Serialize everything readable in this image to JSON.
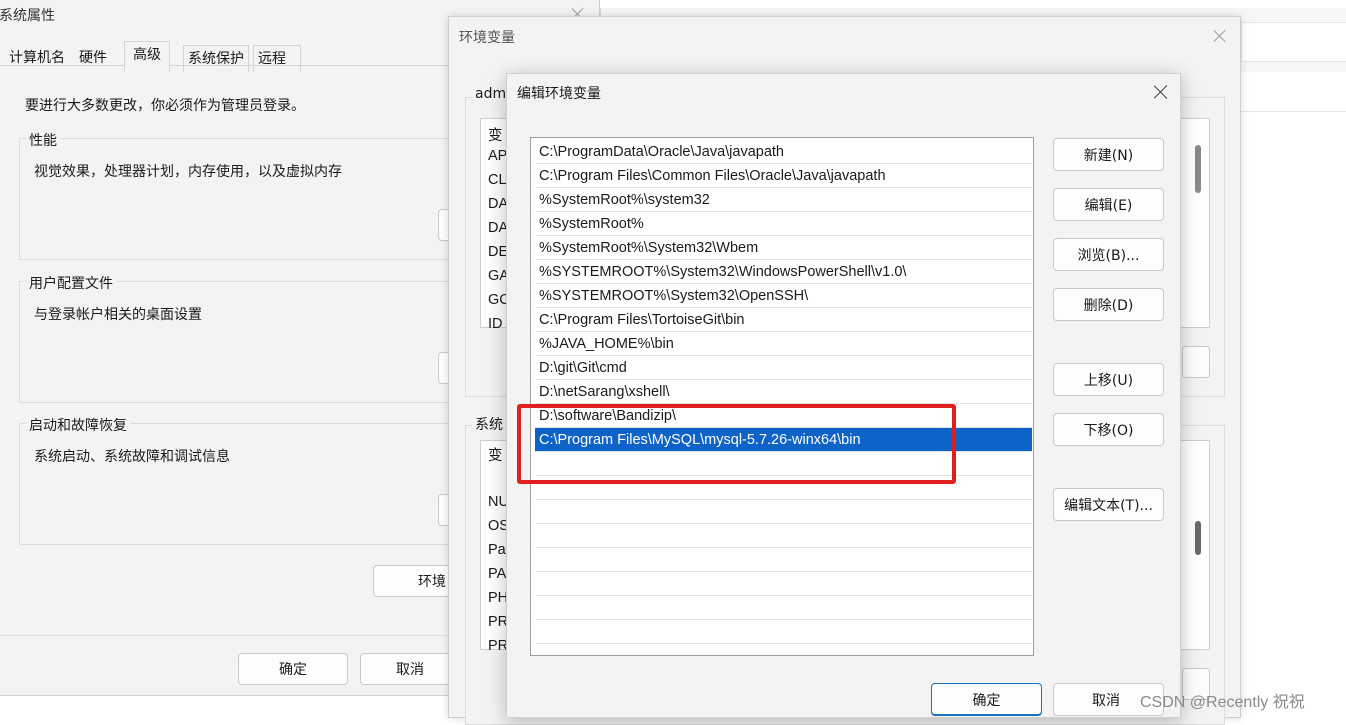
{
  "system_properties": {
    "title": "系统属性",
    "tabs": [
      "计算机名",
      "硬件",
      "高级",
      "系统保护",
      "远程"
    ],
    "admin_note": "要进行大多数更改，你必须作为管理员登录。",
    "performance": {
      "title": "性能",
      "desc": "视觉效果，处理器计划，内存使用，以及虚拟内存"
    },
    "user_profiles": {
      "title": "用户配置文件",
      "desc": "与登录帐户相关的桌面设置"
    },
    "startup_recovery": {
      "title": "启动和故障恢复",
      "desc": "系统启动、系统故障和调试信息"
    },
    "env_button_partial": "环境",
    "ok": "确定",
    "cancel": "取消"
  },
  "env_vars": {
    "title": "环境变量",
    "user_section_partial": "adm",
    "system_section_partial": "系统",
    "user_header_partial": "变",
    "user_vars_partial": [
      "AP",
      "CL",
      "DA",
      "DA",
      "DE",
      "GA",
      "GC",
      "ID"
    ],
    "system_header_partial": "变",
    "system_vars_partial": [
      "NU",
      "OS",
      "Pa",
      "PA",
      "PH",
      "PR",
      "PR"
    ]
  },
  "edit_env": {
    "title": "编辑环境变量",
    "paths": [
      "C:\\ProgramData\\Oracle\\Java\\javapath",
      "C:\\Program Files\\Common Files\\Oracle\\Java\\javapath",
      "%SystemRoot%\\system32",
      "%SystemRoot%",
      "%SystemRoot%\\System32\\Wbem",
      "%SYSTEMROOT%\\System32\\WindowsPowerShell\\v1.0\\",
      "%SYSTEMROOT%\\System32\\OpenSSH\\",
      "C:\\Program Files\\TortoiseGit\\bin",
      "%JAVA_HOME%\\bin",
      "D:\\git\\Git\\cmd",
      "D:\\netSarang\\xshell\\",
      "D:\\software\\Bandizip\\",
      "C:\\Program Files\\MySQL\\mysql-5.7.26-winx64\\bin"
    ],
    "selected_index": 12,
    "buttons": {
      "new": "新建(N)",
      "edit": "编辑(E)",
      "browse": "浏览(B)...",
      "delete": "删除(D)",
      "move_up": "上移(U)",
      "move_down": "下移(O)",
      "edit_text": "编辑文本(T)..."
    },
    "ok": "确定",
    "cancel": "取消"
  },
  "watermark": "CSDN @Recently 祝祝",
  "colors": {
    "selection": "#0e63c9",
    "highlight_box": "#e02020",
    "primary_border": "#1f6fc2"
  }
}
